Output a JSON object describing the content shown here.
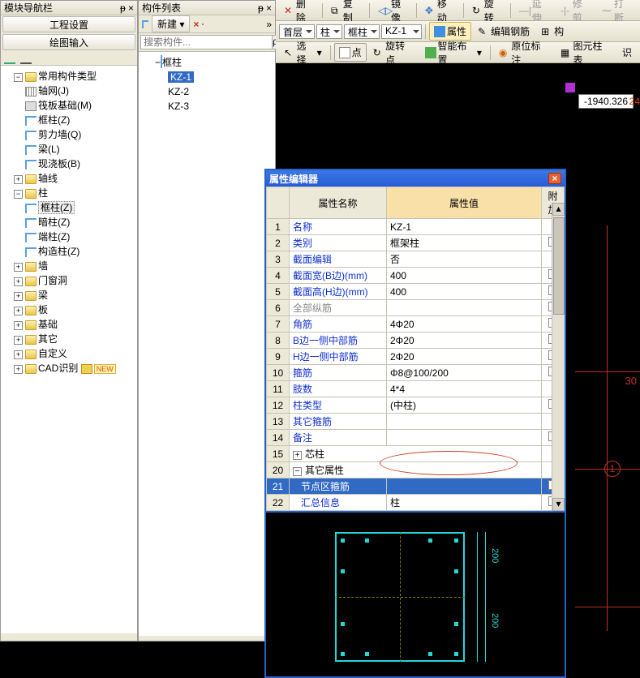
{
  "nav": {
    "title": "模块导航栏",
    "pin": "ᵽ",
    "close": "×",
    "tabs": {
      "t1": "工程设置",
      "t2": "绘图输入"
    },
    "tree": {
      "root": "常用构件类型",
      "items": [
        "轴网(J)",
        "筏板基础(M)",
        "框柱(Z)",
        "剪力墙(Q)",
        "梁(L)",
        "现浇板(B)"
      ],
      "groups": [
        "轴线",
        "柱",
        "墙",
        "门窗洞",
        "梁",
        "板",
        "基础",
        "其它",
        "自定义",
        "CAD识别"
      ],
      "zhu_items": [
        "框柱(Z)",
        "暗柱(Z)",
        "端柱(Z)",
        "构造柱(Z)"
      ],
      "new_badge": "NEW"
    }
  },
  "list": {
    "title": "构件列表",
    "pin": "ᵽ",
    "close": "×",
    "new_btn": "新建",
    "del_icon": "×",
    "filter_icon": "▦",
    "search_ph": "搜索构件...",
    "search_btn": "ρ",
    "root": "框柱",
    "items": [
      "KZ-1",
      "KZ-2",
      "KZ-3"
    ]
  },
  "tb1": {
    "del": "删除",
    "copy": "复制",
    "mirror": "镜像",
    "move": "移动",
    "rotate": "旋转",
    "extend": "延伸",
    "trim": "修剪",
    "break": "打断"
  },
  "tb2": {
    "floor": "首层",
    "cat": "柱",
    "sub": "框柱",
    "inst": "KZ-1",
    "prop": "属性",
    "editrebar": "编辑钢筋",
    "schema": "构"
  },
  "tb3": {
    "select": "选择",
    "point": "点",
    "rotpoint": "旋转点",
    "smart": "智能布置",
    "origin": "原位标注",
    "chart": "图元柱表",
    "ref": "识"
  },
  "canvas": {
    "coord": "-1940.326",
    "coord2": "24",
    "dim_30": "30",
    "circ_1": "1"
  },
  "dlg": {
    "title": "属性编辑器",
    "col_name": "属性名称",
    "col_val": "属性值",
    "col_add": "附加",
    "rows": [
      {
        "n": "1",
        "name": "名称",
        "val": "KZ-1",
        "link": true,
        "ck": false
      },
      {
        "n": "2",
        "name": "类别",
        "val": "框架柱",
        "link": true,
        "ck": true
      },
      {
        "n": "3",
        "name": "截面编辑",
        "val": "否",
        "link": true,
        "ck": false
      },
      {
        "n": "4",
        "name": "截面宽(B边)(mm)",
        "val": "400",
        "link": true,
        "ck": true
      },
      {
        "n": "5",
        "name": "截面高(H边)(mm)",
        "val": "400",
        "link": true,
        "ck": true
      },
      {
        "n": "6",
        "name": "全部纵筋",
        "val": "",
        "gray": true,
        "ck": true
      },
      {
        "n": "7",
        "name": "角筋",
        "val": "4Φ20",
        "link": true,
        "ck": true
      },
      {
        "n": "8",
        "name": "B边一侧中部筋",
        "val": "2Φ20",
        "link": true,
        "ck": true
      },
      {
        "n": "9",
        "name": "H边一侧中部筋",
        "val": "2Φ20",
        "link": true,
        "ck": true
      },
      {
        "n": "10",
        "name": "箍筋",
        "val": "Φ8@100/200",
        "link": true,
        "ck": true
      },
      {
        "n": "11",
        "name": "肢数",
        "val": "4*4",
        "link": true,
        "ck": false
      },
      {
        "n": "12",
        "name": "柱类型",
        "val": "(中柱)",
        "link": true,
        "ck": true
      },
      {
        "n": "13",
        "name": "其它箍筋",
        "val": "",
        "link": true,
        "ck": false
      },
      {
        "n": "14",
        "name": "备注",
        "val": "",
        "link": true,
        "ck": true
      }
    ],
    "grp1_n": "15",
    "grp1": "芯柱",
    "grp2_n": "20",
    "grp2": "其它属性",
    "sel_n": "21",
    "sel_name": "节点区箍筋",
    "sel_val": "",
    "last_n": "22",
    "last_name": "汇总信息",
    "last_val": "柱",
    "dim200a": "200",
    "dim200b": "200"
  }
}
